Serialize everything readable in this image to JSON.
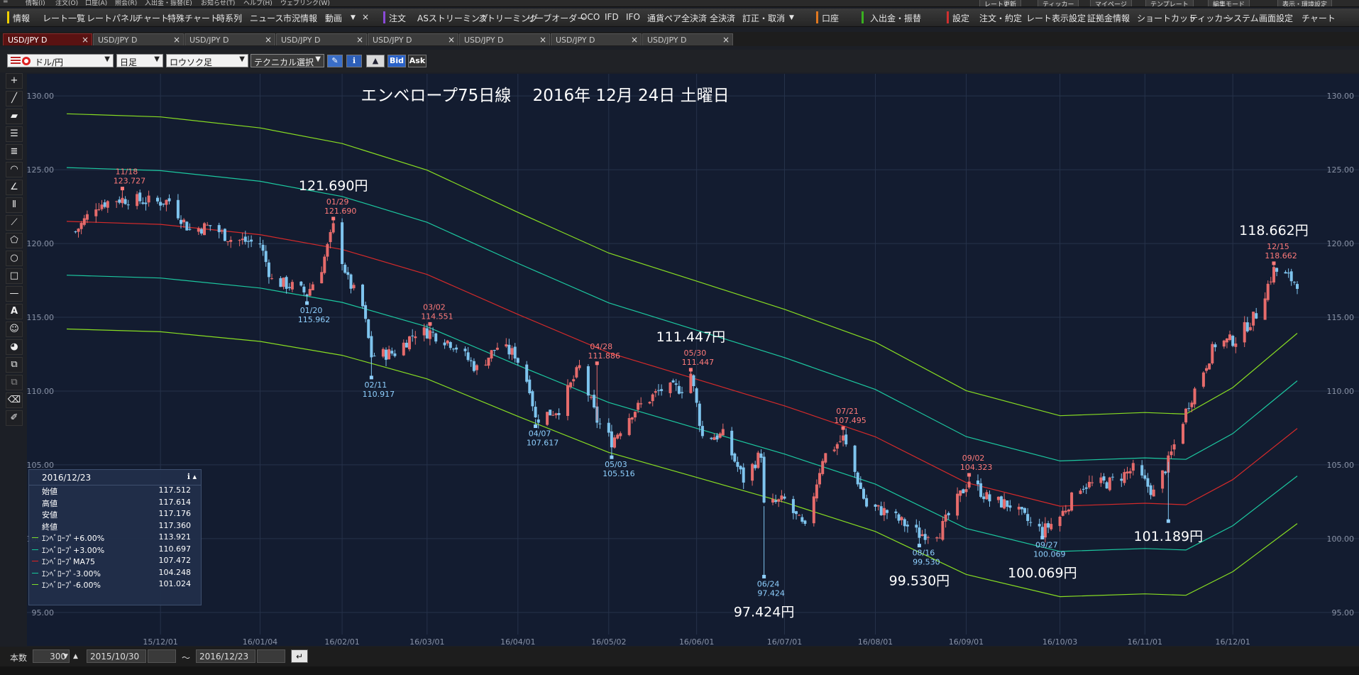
{
  "menubar": {
    "items": [
      "情報(I)",
      "注文(O)",
      "口座(A)",
      "照会(R)",
      "入出金・振替(E)",
      "お知らせ(T)",
      "ヘルプ(H)",
      "ウェブリンク(W)"
    ],
    "right_buttons": [
      "レート更新",
      "ティッカー",
      "マイページ",
      "テンプレート",
      "編集モード",
      "表示・環境設定"
    ]
  },
  "toolbar": {
    "items": [
      "情報",
      "レート一覧",
      "レートパネル",
      "チャート",
      "特殊チャート",
      "時系列",
      "ニュース",
      "市況情報",
      "動画",
      "注文",
      "ASストリーミング",
      "ストリーミング",
      "リーブオーダー",
      "OCO",
      "IFD",
      "IFO",
      "通貨ペア全決済",
      "全決済",
      "訂正・取消",
      "口座",
      "入出金・振替",
      "設定",
      "注文・約定",
      "レート表示設定",
      "証拠金情報",
      "ショートカット",
      "ティッカー",
      "システム",
      "画面設定",
      "チャート"
    ]
  },
  "tabs": [
    {
      "label": "USD/JPY D",
      "active": true
    },
    {
      "label": "USD/JPY D",
      "active": false
    },
    {
      "label": "USD/JPY D",
      "active": false
    },
    {
      "label": "USD/JPY D",
      "active": false
    },
    {
      "label": "USD/JPY D",
      "active": false
    },
    {
      "label": "USD/JPY D",
      "active": false
    },
    {
      "label": "USD/JPY D",
      "active": false
    },
    {
      "label": "USD/JPY D",
      "active": false
    }
  ],
  "controls": {
    "pair": "ドル/円",
    "timeframe": "日足",
    "chart_type": "ロウソク足",
    "technical": "テクニカル選択",
    "bid": "Bid",
    "ask": "Ask"
  },
  "side_tools": [
    "crosshair-icon",
    "line-icon",
    "ruler-icon",
    "hlines-icon",
    "hlines2-icon",
    "fan-icon",
    "angle-icon",
    "vlines-icon",
    "trend-icon",
    "pentagon-icon",
    "circle-icon",
    "rectangle-icon",
    "hline-icon",
    "text-icon",
    "emoji-icon",
    "paint-icon",
    "copy-icon",
    "paste-icon",
    "eraser-icon",
    "pin-icon"
  ],
  "side_tool_text": {
    "text": "A",
    "emoji": "☺"
  },
  "info_box": {
    "date": "2016/12/23",
    "rows": [
      {
        "label": "始値",
        "value": "117.512",
        "color": ""
      },
      {
        "label": "高値",
        "value": "117.614",
        "color": ""
      },
      {
        "label": "安値",
        "value": "117.176",
        "color": ""
      },
      {
        "label": "終値",
        "value": "117.360",
        "color": ""
      },
      {
        "label": "ｴﾝﾍﾞﾛｰﾌﾟ+6.00%",
        "value": "113.921",
        "color": "#7ddc2a"
      },
      {
        "label": "ｴﾝﾍﾞﾛｰﾌﾟ+3.00%",
        "value": "110.697",
        "color": "#14c99a"
      },
      {
        "label": "ｴﾝﾍﾞﾛｰﾌﾟMA75",
        "value": "107.472",
        "color": "#e02020"
      },
      {
        "label": "ｴﾝﾍﾞﾛｰﾌﾟ-3.00%",
        "value": "104.248",
        "color": "#14c99a"
      },
      {
        "label": "ｴﾝﾍﾞﾛｰﾌﾟ-6.00%",
        "value": "101.024",
        "color": "#7ddc2a"
      }
    ]
  },
  "bottom": {
    "count_label": "本数",
    "count_value": "300",
    "from_date": "2015/10/30",
    "tilde": "～",
    "to_date": "2016/12/23"
  },
  "chart_data": {
    "type": "candlestick",
    "title": "エンベロープ75日線　 2016年 12月 24日 土曜日",
    "y_ticks": [
      "130.00",
      "125.00",
      "120.00",
      "115.00",
      "110.00",
      "105.00",
      "100.00",
      "95.00"
    ],
    "ylim": [
      93.5,
      131.5
    ],
    "x_ticks": [
      "15/12/01",
      "16/01/04",
      "16/02/01",
      "16/03/01",
      "16/04/01",
      "16/05/02",
      "16/06/01",
      "16/07/01",
      "16/08/01",
      "16/09/01",
      "16/10/03",
      "16/11/01",
      "16/12/01"
    ],
    "x_range": [
      "2015-10-30",
      "2016-12-23"
    ],
    "grid": true,
    "up_color": "#e66b6b",
    "down_color": "#7ec4ee",
    "bg_color": "#131c30",
    "close_series": [
      {
        "date": "2015-11-02",
        "value": 120.8
      },
      {
        "date": "2015-11-09",
        "value": 122.6
      },
      {
        "date": "2015-11-16",
        "value": 123.0
      },
      {
        "date": "2015-11-20",
        "value": 123.0
      },
      {
        "date": "2015-11-30",
        "value": 122.8
      },
      {
        "date": "2015-12-04",
        "value": 122.9
      },
      {
        "date": "2015-12-11",
        "value": 120.9
      },
      {
        "date": "2015-12-18",
        "value": 121.2
      },
      {
        "date": "2015-12-25",
        "value": 120.3
      },
      {
        "date": "2016-01-04",
        "value": 120.0
      },
      {
        "date": "2016-01-08",
        "value": 117.5
      },
      {
        "date": "2016-01-15",
        "value": 117.1
      },
      {
        "date": "2016-01-20",
        "value": 116.6
      },
      {
        "date": "2016-01-25",
        "value": 118.4
      },
      {
        "date": "2016-01-29",
        "value": 121.1
      },
      {
        "date": "2016-02-03",
        "value": 117.5
      },
      {
        "date": "2016-02-08",
        "value": 115.7
      },
      {
        "date": "2016-02-11",
        "value": 112.4
      },
      {
        "date": "2016-02-19",
        "value": 112.6
      },
      {
        "date": "2016-02-26",
        "value": 114.0
      },
      {
        "date": "2016-03-02",
        "value": 114.0
      },
      {
        "date": "2016-03-10",
        "value": 113.2
      },
      {
        "date": "2016-03-18",
        "value": 111.5
      },
      {
        "date": "2016-03-25",
        "value": 113.0
      },
      {
        "date": "2016-03-31",
        "value": 112.5
      },
      {
        "date": "2016-04-05",
        "value": 110.3
      },
      {
        "date": "2016-04-07",
        "value": 108.1
      },
      {
        "date": "2016-04-15",
        "value": 108.8
      },
      {
        "date": "2016-04-22",
        "value": 111.6
      },
      {
        "date": "2016-04-28",
        "value": 108.0
      },
      {
        "date": "2016-05-03",
        "value": 106.6
      },
      {
        "date": "2016-05-10",
        "value": 108.6
      },
      {
        "date": "2016-05-20",
        "value": 110.1
      },
      {
        "date": "2016-05-27",
        "value": 110.2
      },
      {
        "date": "2016-05-30",
        "value": 111.2
      },
      {
        "date": "2016-06-03",
        "value": 106.9
      },
      {
        "date": "2016-06-10",
        "value": 107.0
      },
      {
        "date": "2016-06-17",
        "value": 104.0
      },
      {
        "date": "2016-06-23",
        "value": 105.8
      },
      {
        "date": "2016-06-24",
        "value": 102.2
      },
      {
        "date": "2016-07-01",
        "value": 102.6
      },
      {
        "date": "2016-07-08",
        "value": 100.6
      },
      {
        "date": "2016-07-14",
        "value": 105.5
      },
      {
        "date": "2016-07-21",
        "value": 106.8
      },
      {
        "date": "2016-07-29",
        "value": 102.2
      },
      {
        "date": "2016-08-05",
        "value": 101.8
      },
      {
        "date": "2016-08-16",
        "value": 100.3
      },
      {
        "date": "2016-08-23",
        "value": 100.5
      },
      {
        "date": "2016-09-02",
        "value": 104.0
      },
      {
        "date": "2016-09-09",
        "value": 102.6
      },
      {
        "date": "2016-09-16",
        "value": 102.3
      },
      {
        "date": "2016-09-23",
        "value": 101.0
      },
      {
        "date": "2016-09-27",
        "value": 100.5
      },
      {
        "date": "2016-10-03",
        "value": 101.5
      },
      {
        "date": "2016-10-10",
        "value": 103.6
      },
      {
        "date": "2016-10-20",
        "value": 103.8
      },
      {
        "date": "2016-10-28",
        "value": 104.7
      },
      {
        "date": "2016-11-04",
        "value": 103.1
      },
      {
        "date": "2016-11-09",
        "value": 105.2
      },
      {
        "date": "2016-11-16",
        "value": 109.2
      },
      {
        "date": "2016-11-25",
        "value": 113.2
      },
      {
        "date": "2016-12-02",
        "value": 113.5
      },
      {
        "date": "2016-12-09",
        "value": 115.2
      },
      {
        "date": "2016-12-15",
        "value": 118.2
      },
      {
        "date": "2016-12-23",
        "value": 117.36
      }
    ],
    "ma75": [
      {
        "date": "2015-10-30",
        "value": 121.5
      },
      {
        "date": "2015-12-01",
        "value": 121.3
      },
      {
        "date": "2016-01-04",
        "value": 120.6
      },
      {
        "date": "2016-02-01",
        "value": 119.6
      },
      {
        "date": "2016-03-01",
        "value": 117.9
      },
      {
        "date": "2016-04-01",
        "value": 115.2
      },
      {
        "date": "2016-05-02",
        "value": 112.6
      },
      {
        "date": "2016-06-01",
        "value": 110.8
      },
      {
        "date": "2016-07-01",
        "value": 109.0
      },
      {
        "date": "2016-08-01",
        "value": 106.9
      },
      {
        "date": "2016-09-01",
        "value": 103.8
      },
      {
        "date": "2016-10-03",
        "value": 102.2
      },
      {
        "date": "2016-11-01",
        "value": 102.4
      },
      {
        "date": "2016-11-15",
        "value": 102.3
      },
      {
        "date": "2016-12-01",
        "value": 104.0
      },
      {
        "date": "2016-12-23",
        "value": 107.47
      }
    ],
    "envelope_pct": [
      6,
      3,
      -3,
      -6
    ],
    "band_colors": {
      "ma": "#d42a2a",
      "pct3": "#1cc8a0",
      "pct6": "#88dd22"
    },
    "annotations": [
      {
        "date": "2015-11-18",
        "value": 123.727,
        "side": "high",
        "label_date": "11/18",
        "label_value": "123.727",
        "big": ""
      },
      {
        "date": "2016-01-20",
        "value": 115.962,
        "side": "low",
        "label_date": "01/20",
        "label_value": "115.962",
        "big": ""
      },
      {
        "date": "2016-01-29",
        "value": 121.69,
        "side": "high",
        "label_date": "01/29",
        "label_value": "121.690",
        "big": "121.690円"
      },
      {
        "date": "2016-02-11",
        "value": 110.917,
        "side": "low",
        "label_date": "02/11",
        "label_value": "110.917",
        "big": ""
      },
      {
        "date": "2016-03-02",
        "value": 114.551,
        "side": "high",
        "label_date": "03/02",
        "label_value": "114.551",
        "big": ""
      },
      {
        "date": "2016-04-07",
        "value": 107.617,
        "side": "low",
        "label_date": "04/07",
        "label_value": "107.617",
        "big": ""
      },
      {
        "date": "2016-04-28",
        "value": 111.886,
        "side": "high",
        "label_date": "04/28",
        "label_value": "111.886",
        "big": ""
      },
      {
        "date": "2016-05-03",
        "value": 105.516,
        "side": "low",
        "label_date": "05/03",
        "label_value": "105.516",
        "big": ""
      },
      {
        "date": "2016-05-30",
        "value": 111.447,
        "side": "high",
        "label_date": "05/30",
        "label_value": "111.447",
        "big": "111.447円"
      },
      {
        "date": "2016-06-24",
        "value": 97.424,
        "side": "low",
        "label_date": "06/24",
        "label_value": "97.424",
        "big": "97.424円"
      },
      {
        "date": "2016-07-21",
        "value": 107.495,
        "side": "high",
        "label_date": "07/21",
        "label_value": "107.495",
        "big": ""
      },
      {
        "date": "2016-08-16",
        "value": 99.53,
        "side": "low",
        "label_date": "08/16",
        "label_value": "99.530",
        "big": "99.530円"
      },
      {
        "date": "2016-09-02",
        "value": 104.323,
        "side": "high",
        "label_date": "09/02",
        "label_value": "104.323",
        "big": ""
      },
      {
        "date": "2016-09-27",
        "value": 100.069,
        "side": "low",
        "label_date": "09/27",
        "label_value": "100.069",
        "big": "100.069円"
      },
      {
        "date": "2016-11-09",
        "value": 101.189,
        "side": "low",
        "label_date": "",
        "label_value": "",
        "big": "101.189円"
      },
      {
        "date": "2016-12-15",
        "value": 118.662,
        "side": "high",
        "label_date": "12/15",
        "label_value": "118.662",
        "big": "118.662円"
      }
    ]
  }
}
